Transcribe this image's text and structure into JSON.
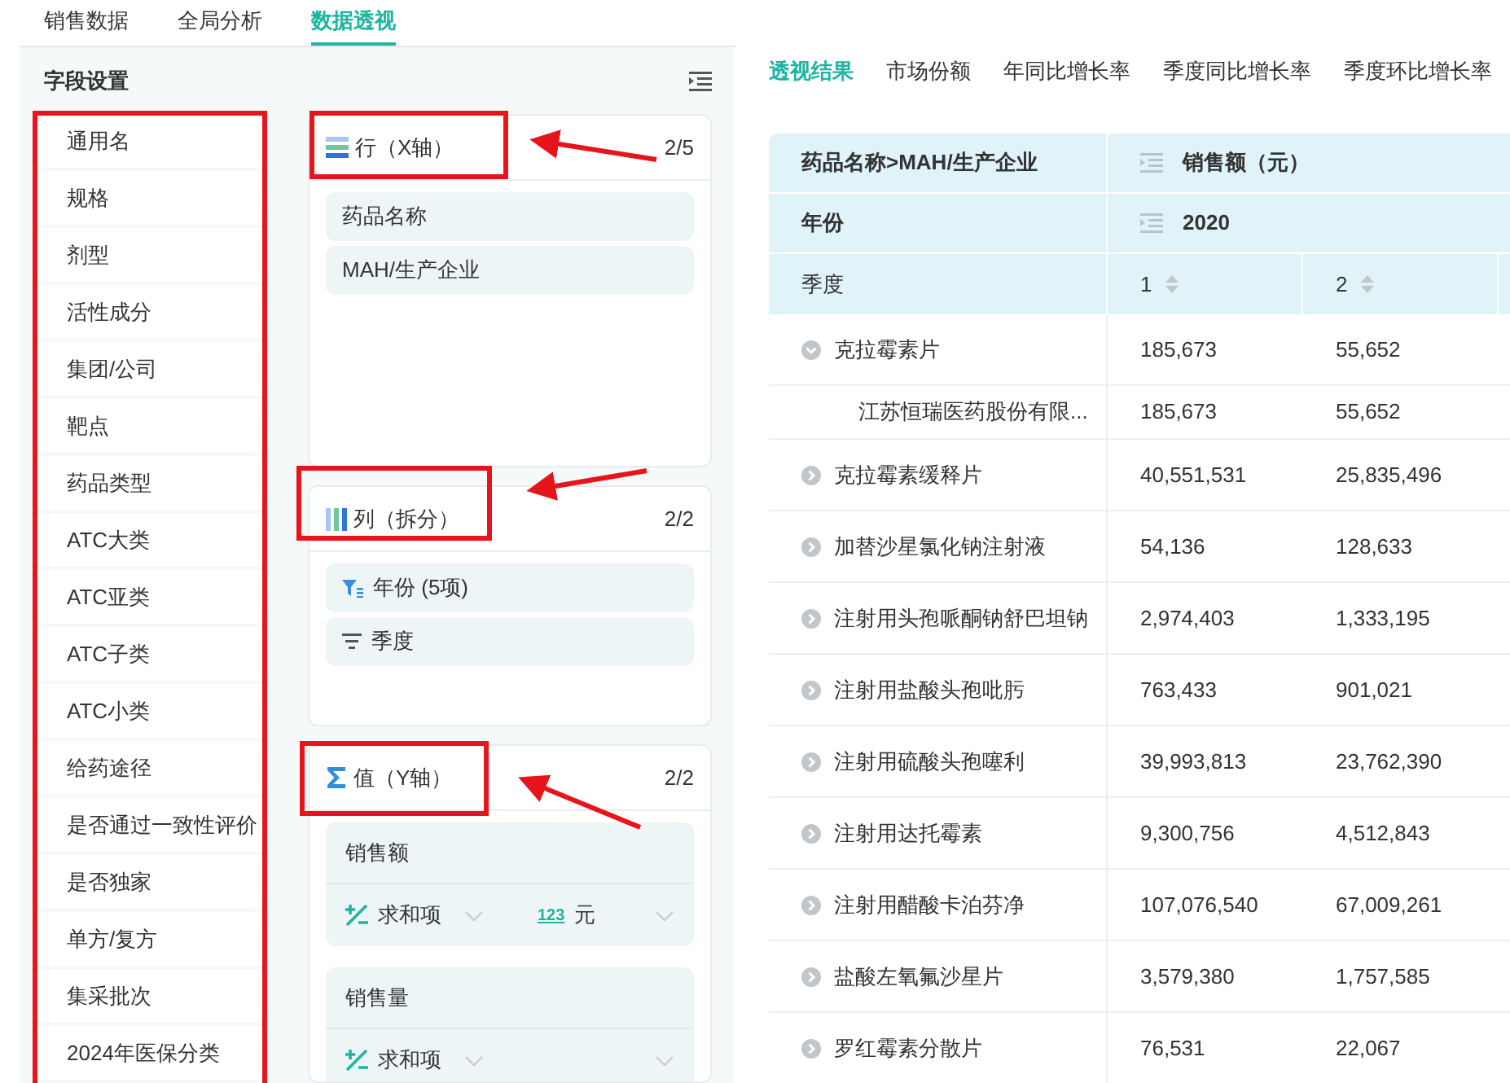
{
  "top_tabs": [
    {
      "label": "销售数据",
      "selected": false
    },
    {
      "label": "全局分析",
      "selected": false
    },
    {
      "label": "数据透视",
      "selected": true
    }
  ],
  "field_settings": {
    "title": "字段设置",
    "items": [
      "通用名",
      "规格",
      "剂型",
      "活性成分",
      "集团/公司",
      "靶点",
      "药品类型",
      "ATC大类",
      "ATC亚类",
      "ATC子类",
      "ATC小类",
      "给药途径",
      "是否通过一致性评价",
      "是否独家",
      "单方/复方",
      "集采批次",
      "2024年医保分类"
    ]
  },
  "zones": [
    {
      "kind": "rows",
      "title": "行（X轴）",
      "count": "2/5",
      "fields": [
        {
          "label": "药品名称",
          "kind": "plain"
        },
        {
          "label": "MAH/生产企业",
          "kind": "plain"
        }
      ]
    },
    {
      "kind": "columns",
      "title": "列（拆分）",
      "count": "2/2",
      "fields": [
        {
          "label": "年份 (5项)",
          "kind": "filtered"
        },
        {
          "label": "季度",
          "kind": "sorted"
        }
      ]
    },
    {
      "kind": "values",
      "title": "值（Y轴）",
      "count": "2/2",
      "fields": [
        {
          "label": "销售额",
          "aggregate": "求和项",
          "unit_badge": "123",
          "unit": "元"
        },
        {
          "label": "销售量",
          "aggregate": "求和项"
        }
      ]
    }
  ],
  "result_tabs": [
    {
      "label": "透视结果",
      "selected": true
    },
    {
      "label": "市场份额",
      "selected": false
    },
    {
      "label": "年同比增长率",
      "selected": false
    },
    {
      "label": "季度同比增长率",
      "selected": false
    },
    {
      "label": "季度环比增长率",
      "selected": false
    }
  ],
  "table": {
    "header": {
      "row_label": "药品名称>MAH/生产企业",
      "measure": "销售额（元）",
      "year_label": "年份",
      "year": "2020",
      "quarter_label": "季度",
      "quarters": [
        "1",
        "2"
      ]
    },
    "rows": [
      {
        "name": "克拉霉素片",
        "expanded": true,
        "values": [
          "185,673",
          "55,652"
        ],
        "children": [
          {
            "name": "江苏恒瑞医药股份有限...",
            "values": [
              "185,673",
              "55,652"
            ]
          }
        ]
      },
      {
        "name": "克拉霉素缓释片",
        "expanded": false,
        "values": [
          "40,551,531",
          "25,835,496"
        ]
      },
      {
        "name": "加替沙星氯化钠注射液",
        "expanded": false,
        "values": [
          "54,136",
          "128,633"
        ]
      },
      {
        "name": "注射用头孢哌酮钠舒巴坦钠",
        "expanded": false,
        "values": [
          "2,974,403",
          "1,333,195"
        ]
      },
      {
        "name": "注射用盐酸头孢吡肟",
        "expanded": false,
        "values": [
          "763,433",
          "901,021"
        ]
      },
      {
        "name": "注射用硫酸头孢噻利",
        "expanded": false,
        "values": [
          "39,993,813",
          "23,762,390"
        ]
      },
      {
        "name": "注射用达托霉素",
        "expanded": false,
        "values": [
          "9,300,756",
          "4,512,843"
        ]
      },
      {
        "name": "注射用醋酸卡泊芬净",
        "expanded": false,
        "values": [
          "107,076,540",
          "67,009,261"
        ]
      },
      {
        "name": "盐酸左氧氟沙星片",
        "expanded": false,
        "values": [
          "3,579,380",
          "1,757,585"
        ]
      },
      {
        "name": "罗红霉素分散片",
        "expanded": false,
        "values": [
          "76,531",
          "22,067"
        ]
      }
    ]
  }
}
